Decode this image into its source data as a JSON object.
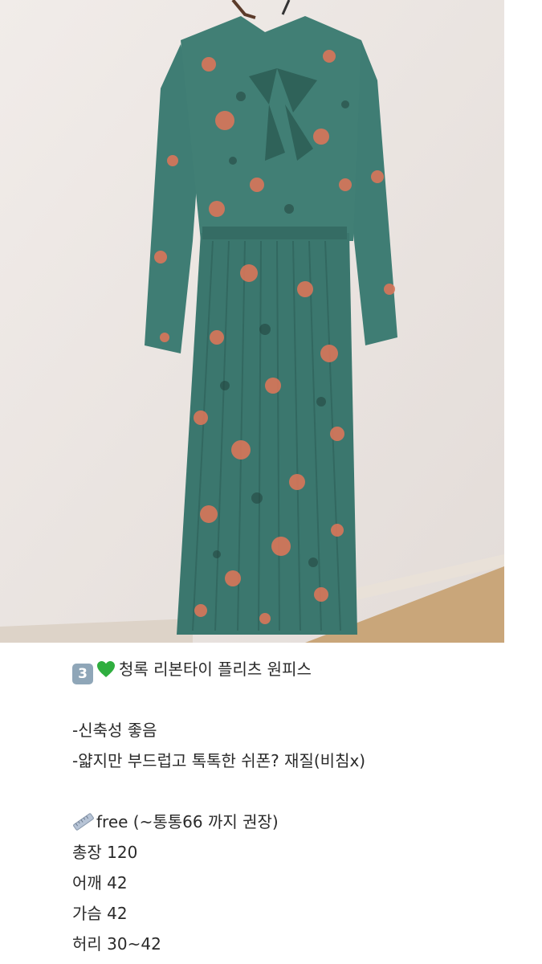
{
  "post": {
    "title_number": "3",
    "title": "청록 리본타이 플리츠 원피스",
    "features": [
      "-신축성 좋음",
      "-얇지만 부드럽고 톡톡한 쉬폰? 재질(비침x)"
    ],
    "size_line": "free (~통통66 까지 권장)",
    "measurements": [
      "총장 120",
      "어깨 42",
      "가슴 42",
      "허리 30~42"
    ]
  },
  "icons": {
    "number": "keycap-3-icon",
    "heart": "green-heart-icon",
    "ruler": "ruler-icon"
  },
  "colors": {
    "dress": "#3f7d74",
    "flower": "#d9765a",
    "wall": "#ece6e3",
    "floor": "#c9a67a",
    "heart": "#2fae3f"
  }
}
